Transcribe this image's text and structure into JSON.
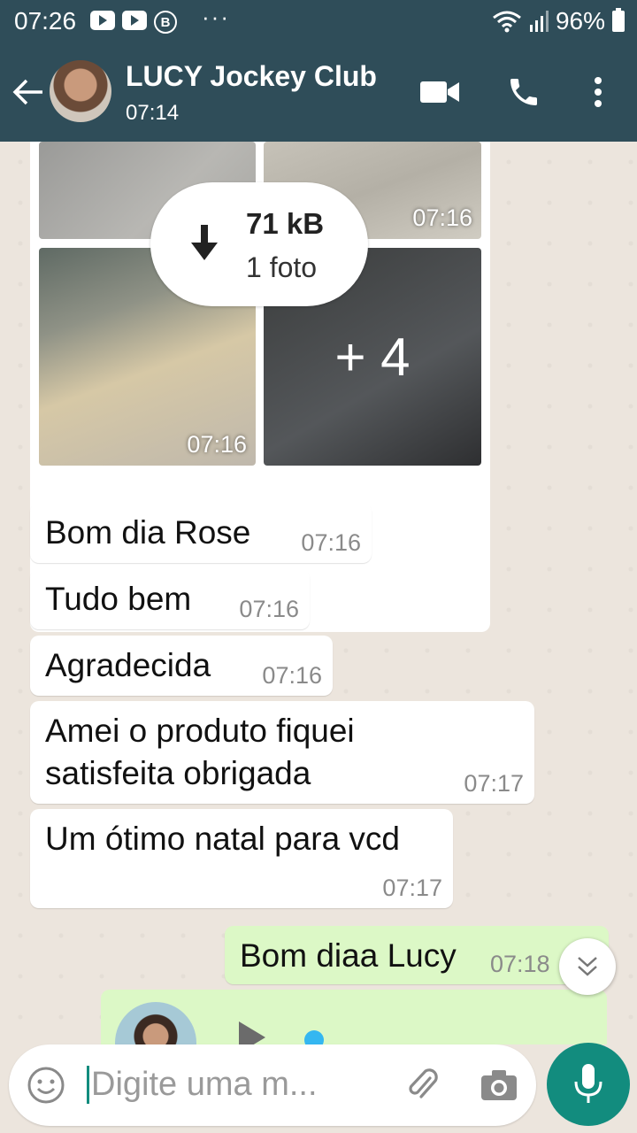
{
  "status_bar": {
    "time": "07:26",
    "dots": "···",
    "battery": "96%"
  },
  "header": {
    "name": "LUCY Jockey Club",
    "last_seen": "07:14"
  },
  "gallery": {
    "download_size": "71 kB",
    "download_count": "1 foto",
    "tile_times": [
      "07:16",
      "07:16"
    ],
    "more_label": "+ 4"
  },
  "messages": [
    {
      "text": "Bom dia Rose",
      "time": "07:16"
    },
    {
      "text": "Tudo bem",
      "time": "07:16"
    },
    {
      "text": "Agradecida",
      "time": "07:16"
    },
    {
      "text": "Amei o produto fiquei\nsatisfeita obrigada",
      "time": "07:17"
    },
    {
      "text": "Um ótimo natal para vcd",
      "time": "07:17"
    }
  ],
  "outgoing": [
    {
      "text": "Bom diaa Lucy",
      "time": "07:18"
    }
  ],
  "composer": {
    "placeholder": "Digite uma m..."
  },
  "colors": {
    "header": "#2f4d59",
    "outgoing_bubble": "#dcf8c6",
    "fab": "#128c7e",
    "accent_blue": "#34b7f1"
  }
}
